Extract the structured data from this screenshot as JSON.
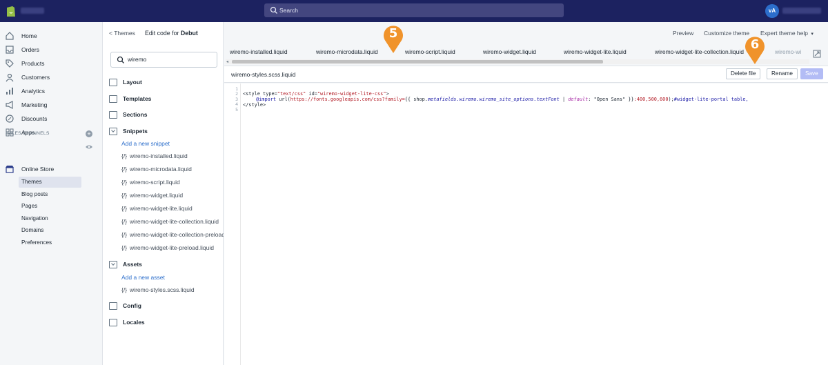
{
  "topbar": {
    "search_placeholder": "Search",
    "avatar_initials": "vA"
  },
  "sidebar": {
    "items": [
      {
        "label": "Home",
        "icon": "home-icon"
      },
      {
        "label": "Orders",
        "icon": "orders-icon"
      },
      {
        "label": "Products",
        "icon": "tag-icon"
      },
      {
        "label": "Customers",
        "icon": "customers-icon"
      },
      {
        "label": "Analytics",
        "icon": "analytics-icon"
      },
      {
        "label": "Marketing",
        "icon": "megaphone-icon"
      },
      {
        "label": "Discounts",
        "icon": "discount-icon"
      },
      {
        "label": "Apps",
        "icon": "apps-icon"
      }
    ],
    "channels_title": "SALES CHANNELS",
    "online_store": "Online Store",
    "sub_items": [
      "Themes",
      "Blog posts",
      "Pages",
      "Navigation",
      "Domains",
      "Preferences"
    ],
    "active_sub": "Themes"
  },
  "header": {
    "back_label": "Themes",
    "edit_prefix": "Edit code for ",
    "theme_name": "Debut",
    "preview": "Preview",
    "customize": "Customize theme",
    "expert_help": "Expert theme help"
  },
  "filepanel": {
    "search_value": "wiremo",
    "folders": {
      "layout": "Layout",
      "templates": "Templates",
      "sections": "Sections",
      "snippets": "Snippets",
      "assets": "Assets",
      "config": "Config",
      "locales": "Locales"
    },
    "add_snippet": "Add a new snippet",
    "snippet_files": [
      "wiremo-installed.liquid",
      "wiremo-microdata.liquid",
      "wiremo-script.liquid",
      "wiremo-widget.liquid",
      "wiremo-widget-lite.liquid",
      "wiremo-widget-lite-collection.liquid",
      "wiremo-widget-lite-collection-preload.liquid",
      "wiremo-widget-lite-preload.liquid"
    ],
    "add_asset": "Add a new asset",
    "asset_files": [
      "wiremo-styles.scss.liquid"
    ],
    "file_prefix": "{/}"
  },
  "editor": {
    "tabs": [
      "wiremo-installed.liquid",
      "wiremo-microdata.liquid",
      "wiremo-script.liquid",
      "wiremo-widget.liquid",
      "wiremo-widget-lite.liquid",
      "wiremo-widget-lite-collection.liquid",
      "wiremo-wi"
    ],
    "current_file": "wiremo-styles.scss.liquid",
    "buttons": {
      "delete": "Delete file",
      "rename": "Rename",
      "save": "Save"
    },
    "line_numbers": [
      "1",
      "2",
      "3",
      "4",
      "5"
    ],
    "code": {
      "l1_tag_open": "<style type=",
      "l1_type_val": "\"text/css\"",
      "l1_id": " id=",
      "l1_id_val": "\"wiremo-widget-lite-css\"",
      "l1_close": ">",
      "l2_at": "@import",
      "l2_url_open": " url(",
      "l2_url": "https://fonts.googleapis.com/css?family=",
      "l2_liquid_open": "{{ shop.",
      "l2_liquid_var": "metafields.wiremo.wiremo_site_options.textFont",
      "l2_pipe": " | ",
      "l2_default": "default",
      "l2_default_val": ": \"Open Sans\" }}",
      "l2_weights": ":400,500,600",
      "l2_rest": ");",
      "l2_selector": "#widget-lite-portal table,",
      "l4": "</style>"
    }
  },
  "markers": {
    "m5": "5",
    "m6": "6"
  },
  "colors": {
    "topbar": "#1c2260",
    "accent": "#2c6ecb",
    "marker": "#f0932b",
    "save_disabled": "#b3bcf5"
  }
}
